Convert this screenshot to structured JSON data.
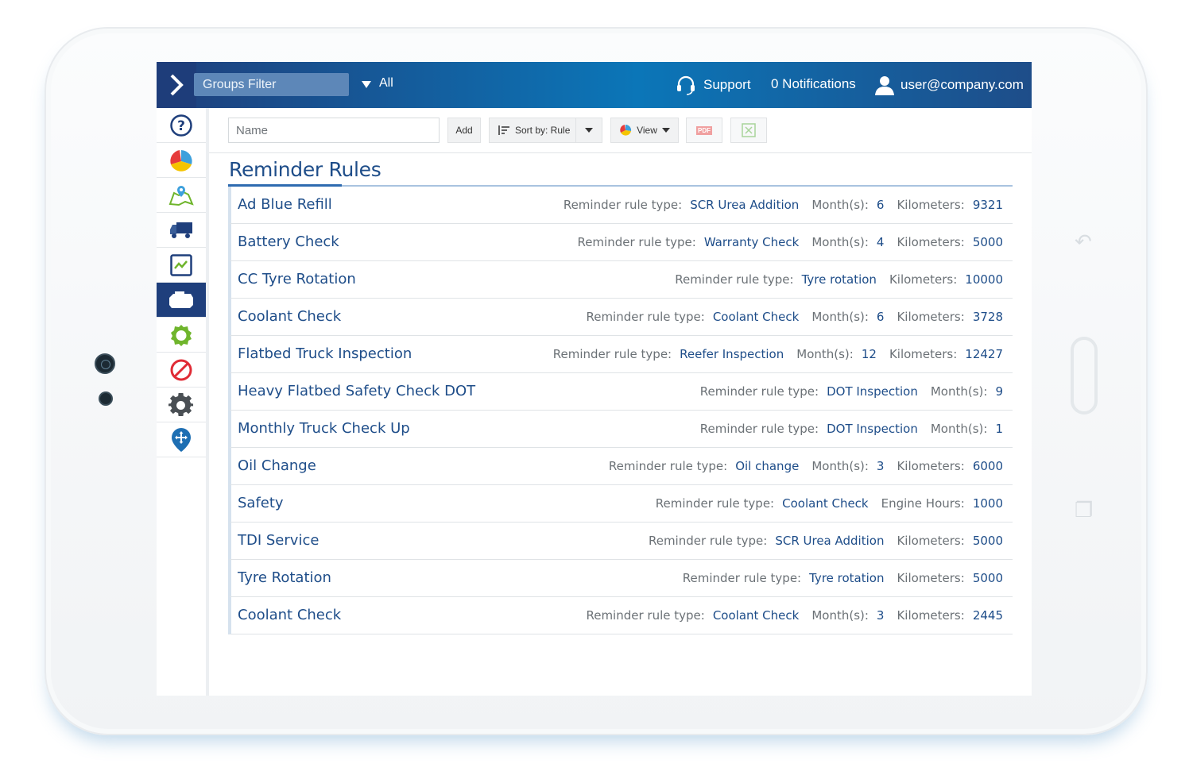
{
  "topbar": {
    "groups_filter": "Groups Filter",
    "all_label": "All",
    "support_label": "Support",
    "notifications_label": "0 Notifications",
    "user_email": "user@company.com"
  },
  "sidebar": {
    "items": [
      {
        "icon": "help-icon"
      },
      {
        "icon": "pie-chart-icon"
      },
      {
        "icon": "map-icon"
      },
      {
        "icon": "truck-icon"
      },
      {
        "icon": "activity-chart-icon"
      },
      {
        "icon": "engine-icon",
        "active": true
      },
      {
        "icon": "gear-outline-icon"
      },
      {
        "icon": "prohibited-icon"
      },
      {
        "icon": "settings-gear-icon"
      },
      {
        "icon": "location-pin-icon"
      }
    ]
  },
  "toolbar": {
    "name_placeholder": "Name",
    "add_label": "Add",
    "sort_label": "Sort by: Rule",
    "view_label": "View",
    "pdf_label": "PDF"
  },
  "page": {
    "title": "Reminder Rules"
  },
  "labels": {
    "rule_type": "Reminder rule type:",
    "months": "Month(s):",
    "kilometers": "Kilometers:",
    "engine_hours": "Engine Hours:"
  },
  "rules": [
    {
      "name": "Ad Blue Refill",
      "type": "SCR Urea Addition",
      "months": "6",
      "kilometers": "9321"
    },
    {
      "name": "Battery Check",
      "type": "Warranty Check",
      "months": "4",
      "kilometers": "5000"
    },
    {
      "name": "CC Tyre Rotation",
      "type": "Tyre rotation",
      "kilometers": "10000"
    },
    {
      "name": "Coolant Check",
      "type": "Coolant Check",
      "months": "6",
      "kilometers": "3728"
    },
    {
      "name": "Flatbed Truck Inspection",
      "type": "Reefer Inspection",
      "months": "12",
      "kilometers": "12427"
    },
    {
      "name": "Heavy Flatbed Safety Check DOT",
      "type": "DOT Inspection",
      "months": "9"
    },
    {
      "name": "Monthly Truck Check Up",
      "type": "DOT Inspection",
      "months": "1"
    },
    {
      "name": "Oil Change",
      "type": "Oil change",
      "months": "3",
      "kilometers": "6000"
    },
    {
      "name": "Safety",
      "type": "Coolant Check",
      "engine_hours": "1000"
    },
    {
      "name": "TDI Service",
      "type": "SCR Urea Addition",
      "kilometers": "5000"
    },
    {
      "name": "Tyre Rotation",
      "type": "Tyre rotation",
      "kilometers": "5000"
    },
    {
      "name": "Coolant Check",
      "type": "Coolant Check",
      "months": "3",
      "kilometers": "2445"
    }
  ],
  "colors": {
    "brand_dark": "#1f3f7c",
    "brand_blue": "#0b76b8",
    "link_blue": "#1e4d89"
  }
}
